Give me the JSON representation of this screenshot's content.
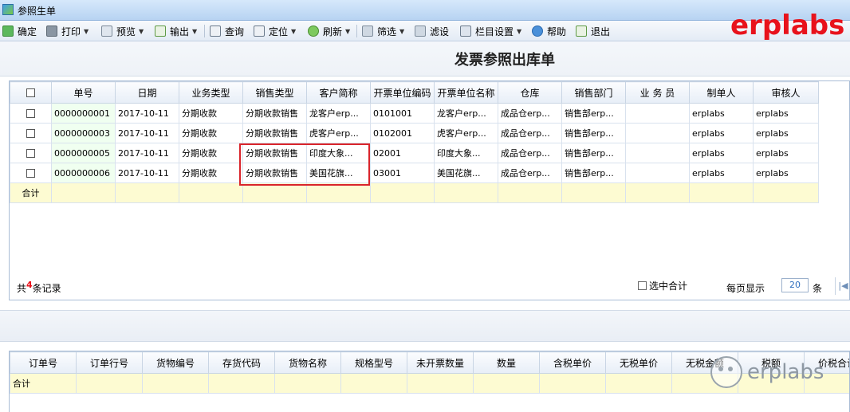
{
  "window": {
    "title": "参照生单"
  },
  "toolbar": {
    "confirm": "确定",
    "print": "打印",
    "preview": "预览",
    "export": "输出",
    "query": "查询",
    "locate": "定位",
    "refresh": "刷新",
    "filter": "筛选",
    "filter_settings": "滤设",
    "column_settings": "栏目设置",
    "help": "帮助",
    "exit": "退出"
  },
  "brand": "erplabs",
  "form_title": "发票参照出库单",
  "top_grid": {
    "columns": [
      "单号",
      "日期",
      "业务类型",
      "销售类型",
      "客户简称",
      "开票单位编码",
      "开票单位名称",
      "仓库",
      "销售部门",
      "业 务 员",
      "制单人",
      "审核人"
    ],
    "rows": [
      [
        "0000000001",
        "2017-10-11",
        "分期收款",
        "分期收款销售",
        "龙客户erp...",
        "0101001",
        "龙客户erp...",
        "成品仓erp...",
        "销售部erp...",
        "",
        "erplabs",
        "erplabs"
      ],
      [
        "0000000003",
        "2017-10-11",
        "分期收款",
        "分期收款销售",
        "虎客户erp...",
        "0102001",
        "虎客户erp...",
        "成品仓erp...",
        "销售部erp...",
        "",
        "erplabs",
        "erplabs"
      ],
      [
        "0000000005",
        "2017-10-11",
        "分期收款",
        "分期收款销售",
        "印度大象...",
        "02001",
        "印度大象...",
        "成品仓erp...",
        "销售部erp...",
        "",
        "erplabs",
        "erplabs"
      ],
      [
        "0000000006",
        "2017-10-11",
        "分期收款",
        "分期收款销售",
        "美国花旗...",
        "03001",
        "美国花旗...",
        "成品仓erp...",
        "销售部erp...",
        "",
        "erplabs",
        "erplabs"
      ]
    ],
    "sum_label": "合计"
  },
  "footer": {
    "count_prefix": "共",
    "count": "4",
    "count_suffix": "条记录",
    "selected_sum": "选中合计",
    "per_page_label": "每页显示",
    "per_page_value": "20",
    "per_page_unit": "条"
  },
  "bottom_grid": {
    "columns": [
      "订单号",
      "订单行号",
      "货物编号",
      "存货代码",
      "货物名称",
      "规格型号",
      "未开票数量",
      "数量",
      "含税单价",
      "无税单价",
      "无税金额",
      "税额",
      "价税合计"
    ],
    "sum_label": "合计"
  },
  "watermark": "erplabs",
  "colors": {
    "brand_red": "#e8121b",
    "highlight_box": "#d9242b",
    "sum_row_bg": "#fdfbd2"
  }
}
